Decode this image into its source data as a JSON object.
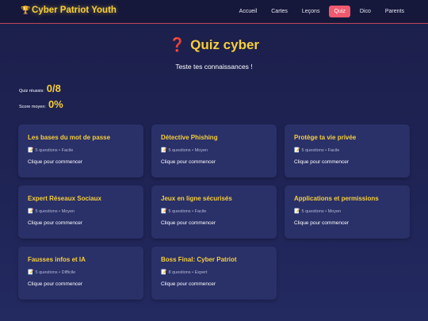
{
  "brand": {
    "icon": "trophy-icon",
    "title": "Cyber Patriot Youth"
  },
  "nav": {
    "items": [
      {
        "label": "Accueil",
        "active": false
      },
      {
        "label": "Cartes",
        "active": false
      },
      {
        "label": "Leçons",
        "active": false
      },
      {
        "label": "Quiz",
        "active": true
      },
      {
        "label": "Dico",
        "active": false
      },
      {
        "label": "Parents",
        "active": false
      }
    ]
  },
  "hero": {
    "icon": "question-mark-icon",
    "title": "Quiz cyber",
    "subtitle": "Teste tes connaissances !"
  },
  "stats": {
    "done_label": "Quiz réussis:",
    "done_value": "0/8",
    "score_label": "Score moyen:",
    "score_value": "0%"
  },
  "quizzes": [
    {
      "title": "Les bases du mot de passe",
      "meta": "5 questions • Facile",
      "cta": "Clique pour commencer"
    },
    {
      "title": "Détective Phishing",
      "meta": "5 questions • Moyen",
      "cta": "Clique pour commencer"
    },
    {
      "title": "Protège ta vie privée",
      "meta": "5 questions • Facile",
      "cta": "Clique pour commencer"
    },
    {
      "title": "Expert Réseaux Sociaux",
      "meta": "5 questions • Moyen",
      "cta": "Clique pour commencer"
    },
    {
      "title": "Jeux en ligne sécurisés",
      "meta": "5 questions • Facile",
      "cta": "Clique pour commencer"
    },
    {
      "title": "Applications et permissions",
      "meta": "5 questions • Moyen",
      "cta": "Clique pour commencer"
    },
    {
      "title": "Fausses infos et IA",
      "meta": "5 questions • Difficile",
      "cta": "Clique pour commencer"
    },
    {
      "title": "Boss Final: Cyber Patriot",
      "meta": "8 questions • Expert",
      "cta": "Clique pour commencer"
    }
  ],
  "colors": {
    "accent_yellow": "#f7cf3a",
    "nav_active": "#ef5a6f",
    "card_bg": "#2a3068",
    "background": "#1f2456"
  }
}
